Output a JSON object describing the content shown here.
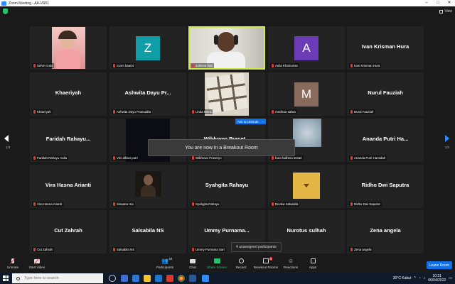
{
  "window": {
    "title": "Zoom Meeting - AA-VR51"
  },
  "topbar": {
    "view_label": "View"
  },
  "participants": [
    {
      "id": "p1",
      "display": "video",
      "label": "Selvin Gulo"
    },
    {
      "id": "p2",
      "display": "avatar",
      "avatar_letter": "Z",
      "avatar_color": "#0f9ea8",
      "label": "zoom baa04"
    },
    {
      "id": "p3",
      "display": "video",
      "label": "sutrisna hati"
    },
    {
      "id": "p4",
      "display": "avatar",
      "avatar_letter": "A",
      "avatar_color": "#6b3bb8",
      "label": "Aulia Khairunisa"
    },
    {
      "id": "p5",
      "display": "name",
      "big_name": "Ivan Krisman Hura",
      "label": "Ivan Krisman Hura"
    },
    {
      "id": "p6",
      "display": "name",
      "big_name": "Khaeriyah",
      "label": "Khaeriyah"
    },
    {
      "id": "p7",
      "display": "name",
      "big_name": "Ashwita Dayu Pr...",
      "label": "Ashwita Dayu Pramudita"
    },
    {
      "id": "p8",
      "display": "video",
      "label": "Linda Nitira"
    },
    {
      "id": "p9",
      "display": "avatar",
      "avatar_letter": "M",
      "avatar_color": "#8a6a5c",
      "label": "medissa salwa"
    },
    {
      "id": "p10",
      "display": "name",
      "big_name": "Nurul Fauziah",
      "label": "Nurul Fauziah"
    },
    {
      "id": "p11",
      "display": "name",
      "big_name": "Faridah  Rahayu...",
      "label": "Faridah Rahayu Aulia"
    },
    {
      "id": "p12",
      "display": "video",
      "label": "Vini alfiani putri"
    },
    {
      "id": "p13",
      "display": "name",
      "big_name": "Wibhowo  Praset...",
      "label": "Wibhowo Prasetyo"
    },
    {
      "id": "p14",
      "display": "video",
      "label": "hara fadhma lestari"
    },
    {
      "id": "p15",
      "display": "name",
      "big_name": "Ananda  Putri  Ha...",
      "label": "Ananda Putri Hamidah"
    },
    {
      "id": "p16",
      "display": "name",
      "big_name": "Vira Hasna Arianti",
      "label": "Vira Hasna Arianti"
    },
    {
      "id": "p17",
      "display": "video",
      "label": "Sisaana Hia"
    },
    {
      "id": "p18",
      "display": "name",
      "big_name": "Syahgita Rahayu",
      "label": "Syahgita Rahayu"
    },
    {
      "id": "p19",
      "display": "video",
      "label": "Devika Salsabila"
    },
    {
      "id": "p20",
      "display": "name",
      "big_name": "Ridho Dwi Saputra",
      "label": "Ridho Dwi Saputra"
    },
    {
      "id": "p21",
      "display": "name",
      "big_name": "Cut Zahrah",
      "label": "Cut Zahrah"
    },
    {
      "id": "p22",
      "display": "name",
      "big_name": "Salsabila NS",
      "label": "Salsabila NS"
    },
    {
      "id": "p23",
      "display": "name",
      "big_name": "Ummy  Purnama...",
      "label": "Ummy Purnama Sari"
    },
    {
      "id": "p24",
      "display": "name",
      "big_name": "Nurotus sulhah",
      "label": ""
    },
    {
      "id": "p25",
      "display": "name",
      "big_name": "Zena angela",
      "label": "Zena angela"
    }
  ],
  "pagination": {
    "left": "1/3",
    "right": "1/3"
  },
  "overlay": {
    "breakout_toast": "You are now in a Breakout Room",
    "ask_to_unmute": "Ask to Unmute",
    "more": "...",
    "unassigned": "4 unassigned participants"
  },
  "controls": {
    "unmute": "Unmute",
    "start_video": "Start Video",
    "participants": "Participants",
    "participants_count": "54",
    "chat": "Chat",
    "share_screen": "Share Screen",
    "record": "Record",
    "breakout_rooms": "Breakout Rooms",
    "breakout_badge": "4",
    "reactions": "Reactions",
    "apps": "Apps",
    "leave_room": "Leave Room"
  },
  "taskbar": {
    "search_placeholder": "Type here to search",
    "weather": "30°C  Kabut",
    "time": "10:31",
    "date": "06/04/2022"
  },
  "colors": {
    "active_speaker": "#cde84a",
    "mic_muted": "#e0393e",
    "accent": "#0e71eb",
    "share_green": "#23c26b"
  }
}
